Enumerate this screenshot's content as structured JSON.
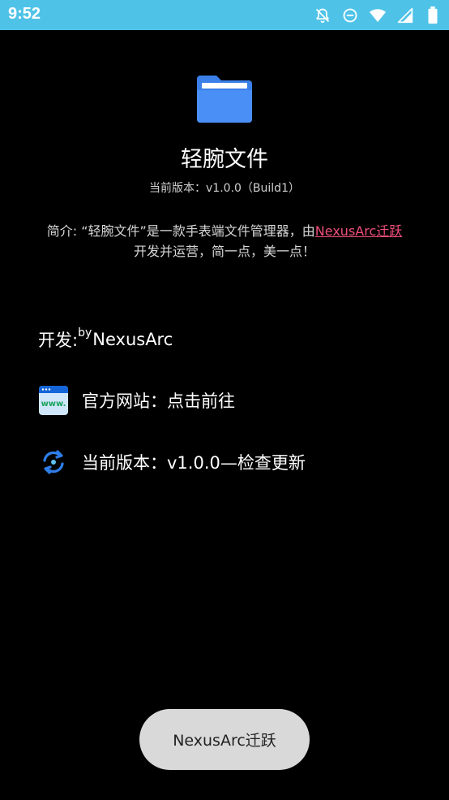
{
  "status_bar": {
    "time": "9:52",
    "icons": [
      "notifications-off-icon",
      "do-not-disturb-icon",
      "wifi-icon",
      "cellular-signal-icon",
      "battery-icon"
    ],
    "background": "#4fc3e7"
  },
  "app": {
    "icon": "folder-icon",
    "title": "轻腕文件",
    "version_line": "当前版本：v1.0.0（Build1）"
  },
  "intro": {
    "prefix": "简介: “轻腕文件”是一款手表端文件管理器，由",
    "link": "NexusArc迁跃",
    "suffix": "开发并运营，简一点，美一点！",
    "link_color": "#f04f7a"
  },
  "developer": {
    "label": "开发: ",
    "by": "by",
    "name": "NexusArc"
  },
  "website": {
    "icon": "www-icon",
    "text": "官方网站：点击前往"
  },
  "update": {
    "icon": "refresh-icon",
    "text": "当前版本：v1.0.0—检查更新"
  },
  "toast": {
    "text": "NexusArc迁跃"
  }
}
